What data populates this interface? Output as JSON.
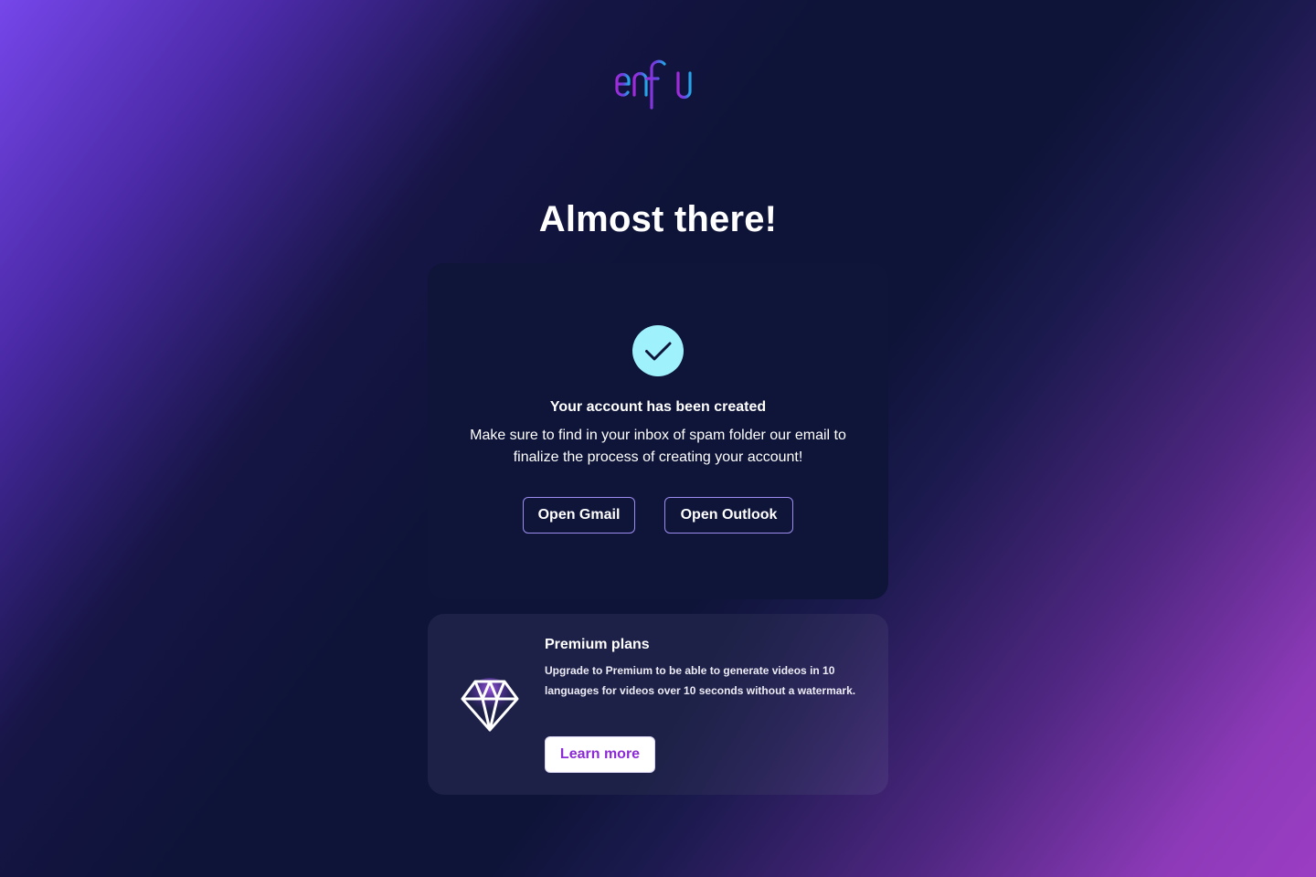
{
  "brand": {
    "logo_text": "enflu",
    "gradient_start": "#9b2bd9",
    "gradient_end": "#26a3e6"
  },
  "page": {
    "title": "Almost there!"
  },
  "confirmation": {
    "icon": "check-icon",
    "icon_color": "#9ff2fb",
    "heading": "Your account has been created",
    "message": "Make sure to find in your inbox of spam folder our email to finalize the process of creating your account!",
    "buttons": {
      "gmail_label": "Open Gmail",
      "outlook_label": "Open Outlook"
    }
  },
  "premium": {
    "icon": "diamond-icon",
    "title": "Premium plans",
    "description": "Upgrade to Premium to be able to generate videos in 10 languages for videos over 10 seconds without a watermark.",
    "button_label": "Learn more",
    "accent": "#8b2bd6"
  }
}
